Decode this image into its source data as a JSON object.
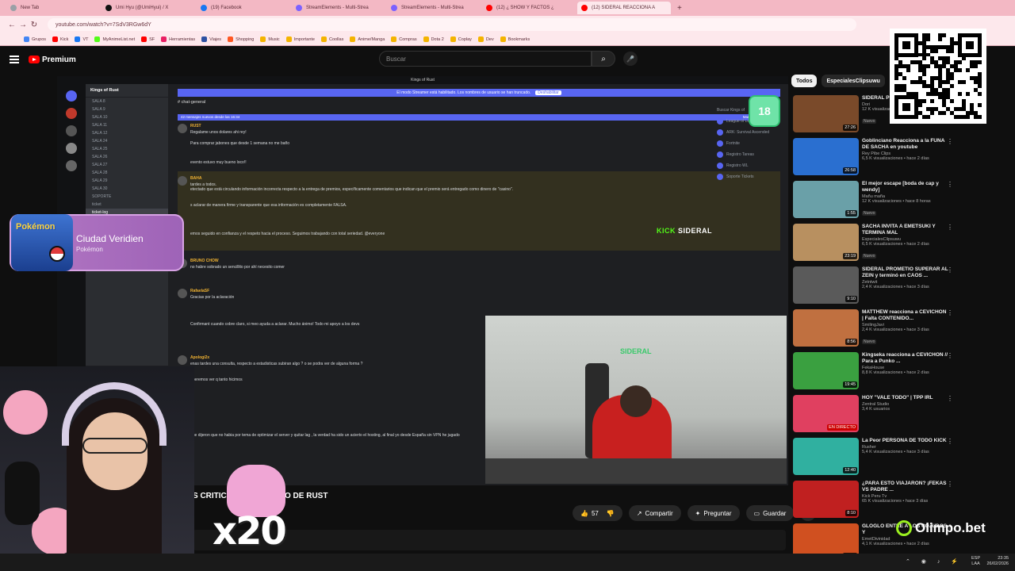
{
  "browser": {
    "tabs": [
      {
        "label": "New Tab",
        "color": "#9aa0a6"
      },
      {
        "label": "Umi Hyu (@UmiHyui) / X",
        "color": "#111111"
      },
      {
        "label": "(19) Facebook",
        "color": "#1877f2"
      },
      {
        "label": "StreamElements - Multi-Strea",
        "color": "#7b61ff"
      },
      {
        "label": "StreamElements - Multi-Strea",
        "color": "#7b61ff"
      },
      {
        "label": "(12) ¿ SHOW Y FACTOS ¿",
        "color": "#ff0000"
      },
      {
        "label": "(12) SIDERAL REACCIONA A",
        "color": "#ff0000",
        "active": true
      }
    ],
    "url": "youtube.com/watch?v=7SdV3RGw6dY",
    "bookmarks": [
      "Grupos",
      "Kick",
      "VT",
      "MyAnimeList.net",
      "SF",
      "Herramientas",
      "Viajes",
      "Shopping",
      "Music",
      "Importante",
      "Coollas",
      "Anime/Manga",
      "Compras",
      "Dota 2",
      "Coplay",
      "Dev",
      "Bookmarks"
    ]
  },
  "youtube": {
    "logo": "Premium",
    "search_placeholder": "Buscar"
  },
  "player": {
    "window_title": "Kings of Rust",
    "banner": "El modo Streamer está habilitado. Los nombres de usuario se han truncado.",
    "banner_button": "Deshabilitar",
    "server_name": "Kings of Rust",
    "channel_name": "chat-general",
    "notice": "42 mensajes nuevos desde las 16:34",
    "notice_right": "Marcar como leído",
    "channels": [
      "SALA 8",
      "SALA 9",
      "SALA 10",
      "SALA 11",
      "SALA 12",
      "SALA 24",
      "SALA 25",
      "SALA 26",
      "SALA 27",
      "SALA 28",
      "SALA 29",
      "SALA 30",
      "SOPORTE",
      "ticket",
      "ticket-log"
    ],
    "members_header": "Buscar Kings of",
    "members": [
      "League of Legends",
      "ARK: Survival Ascended",
      "Fortnite",
      "Registro Tareas",
      "Registro WL",
      "Soporte Tickets"
    ],
    "messages": [
      {
        "user": "RUST",
        "text": "Regalame unos dolares ahi rey!"
      },
      {
        "user": "",
        "text": "Para comprar jabones que desde 1 semana no me baño"
      },
      {
        "user": "",
        "text": "evento estuvo muy bueno loco!!"
      },
      {
        "user": "BAHA",
        "text": "tardes a todos."
      },
      {
        "user": "",
        "text": "etectado que está circulando información incorrecta respecto a la entrega de premios, específicamente comentarios que indican que el premio será entregado como dinero de \"casino\"."
      },
      {
        "user": "",
        "text": "s aclarar de manera firme y transparente que esa información es completamente FALSA."
      },
      {
        "user": "",
        "text": "emos seguido en confianza y el respeto hacia el proceso. Seguimos trabajando con total seriedad. @everyone"
      },
      {
        "user": "BRUNO CHOW",
        "text": "no habre sobrado un sencillito por ahí necesito comer"
      },
      {
        "user": "RafaelaSF",
        "text": "Gracias por la aclaración"
      },
      {
        "user": "",
        "text": "Confirmant cuando cobre claro, si meo ayuda a aclarar. Mucho ánimo! Todo mi apoyo a los devs"
      },
      {
        "user": "Apologi2x",
        "text": "enas tardes una consulta, respecto a estadisticas subiran algo ? o se podra ver de alguna forma ?"
      },
      {
        "user": "",
        "text": "queremos ver q tanto hicimos"
      },
      {
        "user": "",
        "text": "que dijeron que no habia por tema de optimizar el server y quitar lag , la verdad ha sido un acierto el hosting, al final yo desde España sin VPN he jugado"
      }
    ],
    "age_badge": "18",
    "kick_brand": "KICK",
    "kick_user": "SIDERAL",
    "webcam_logo": "SIDERAL"
  },
  "video": {
    "title_visible": "S CRITICA",
    "title_tail": "O DE RUST",
    "likes": "57",
    "share": "Compartir",
    "ask": "Preguntar",
    "save": "Guardar"
  },
  "overlay": {
    "achievement_title": "Ciudad Veridien",
    "achievement_sub": "Pokémon",
    "pokemon_logo": "Pokémon",
    "multiplier": "x20",
    "sponsor": "Olimpo.bet"
  },
  "sidebar": {
    "chips": [
      {
        "label": "Todos",
        "selected": true
      },
      {
        "label": "EspecialesClipsuwu",
        "selected": false
      }
    ],
    "videos": [
      {
        "title": "SIDERAL P Dolares ¿",
        "channel": "Dori",
        "meta": "12 K visualizaciones • hace 10 horas",
        "badge": "Nuevo",
        "duration": "27:26",
        "thumb": "#7a4a2a"
      },
      {
        "title": "Goblinciano Reacciona a la FUNA DE SACHA en youtube",
        "channel": "Rey Pibe Clips",
        "meta": "6,5 K visualizaciones • hace 2 días",
        "badge": "",
        "duration": "26:58",
        "thumb": "#2a6fd0"
      },
      {
        "title": "El mejor escape [boda de cap y wendy]",
        "channel": "Mañu maña",
        "meta": "12 K visualizaciones • hace 8 horas",
        "badge": "Nuevo",
        "duration": "1:55",
        "thumb": "#6aa0a8"
      },
      {
        "title": "SACHA INVITA A EMETSUKI Y TERMINA MAL",
        "channel": "EspecialesClipsuwu",
        "meta": "6,5 K visualizaciones • hace 2 días",
        "badge": "Nuevo",
        "duration": "23:19",
        "thumb": "#b89060"
      },
      {
        "title": "SIDERAL PROMETIO SUPERAR AL ZEIN y terminó en CAOS ...",
        "channel": "Zetntwit",
        "meta": "2,4 K visualizaciones • hace 3 días",
        "badge": "",
        "duration": "9:10",
        "thumb": "#5a5a5a"
      },
      {
        "title": "MATTHEW reacciona a CEVICHON | Falta CONTENIDO...",
        "channel": "SmilingJavi",
        "meta": "2,4 K visualizaciones • hace 3 días",
        "badge": "Nuevo",
        "duration": "8:56",
        "thumb": "#c07040"
      },
      {
        "title": "Kingseka reacciona a CEVICHON // Para a Punko ...",
        "channel": "FekaHouse",
        "meta": "8,8 K visualizaciones • hace 2 días",
        "badge": "",
        "duration": "19:45",
        "thumb": "#3aa040"
      },
      {
        "title": "HOY \"VALE TODO\" | TPP IRL",
        "channel": "Zentral Studio",
        "meta": "3,4 K usuarios",
        "badge": "",
        "duration": "EN DIRECTO",
        "thumb": "#e04060"
      },
      {
        "title": "La Peor PERSONA DE TODO KICK",
        "channel": "Rusher",
        "meta": "5,4 K visualizaciones • hace 3 días",
        "badge": "",
        "duration": "12:40",
        "thumb": "#30b0a0"
      },
      {
        "title": "¿PARA ESTO VIAJARON? ¡FEKAS VS PADRE ...",
        "channel": "Kick Peru Tv",
        "meta": "65 K visualizaciones • hace 3 días",
        "badge": "",
        "duration": "8:10",
        "thumb": "#c02020"
      },
      {
        "title": "GLOGLO ENTRE A LOS COJUDOS Y",
        "channel": "EmetDivinidad",
        "meta": "4,1 K visualizaciones • hace 2 días",
        "badge": "",
        "duration": "12:21",
        "thumb": "#d05020"
      }
    ]
  },
  "taskbar": {
    "lang": "ESP",
    "lang2": "LAA",
    "time": "23:35",
    "date": "26/02/2026"
  }
}
